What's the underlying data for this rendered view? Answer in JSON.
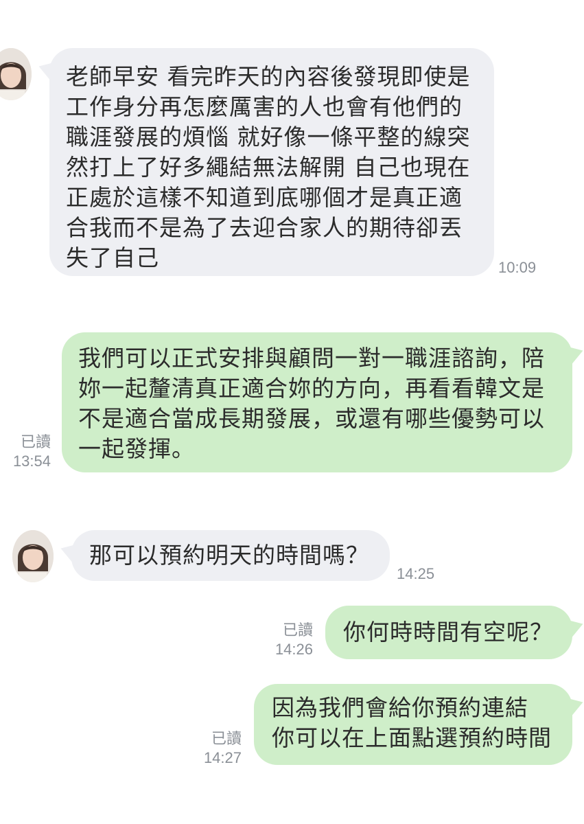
{
  "messages": [
    {
      "direction": "incoming",
      "text": "老師早安 看完昨天的內容後發現即使是\n工作身分再怎麼厲害的人也會有他們的\n職涯發展的煩惱 就好像一條平整的線突\n然打上了好多繩結無法解開 自己也現在\n正處於這樣不知道到底哪個才是真正適\n合我而不是為了去迎合家人的期待卻丟\n失了自己",
      "time": "10:09"
    },
    {
      "direction": "outgoing",
      "text": "我們可以正式安排與顧問一對一職涯諮詢，陪\n妳一起釐清真正適合妳的方向，再看看韓文是\n不是適合當成長期發展，或還有哪些優勢可以\n一起發揮。",
      "read": "已讀",
      "time": "13:54"
    },
    {
      "direction": "incoming",
      "text": "那可以預約明天的時間嗎？",
      "time": "14:25"
    },
    {
      "direction": "outgoing",
      "text": "你何時時間有空呢？",
      "read": "已讀",
      "time": "14:26"
    },
    {
      "direction": "outgoing",
      "text": "因為我們會給你預約連結\n你可以在上面點選預約時間",
      "read": "已讀",
      "time": "14:27"
    }
  ],
  "colors": {
    "incoming_bubble": "#eeeff3",
    "outgoing_bubble": "#cfeec9",
    "meta_text": "#8a8f96",
    "background": "#ffffff"
  },
  "icons": {
    "avatar": "contact-avatar-photo"
  }
}
